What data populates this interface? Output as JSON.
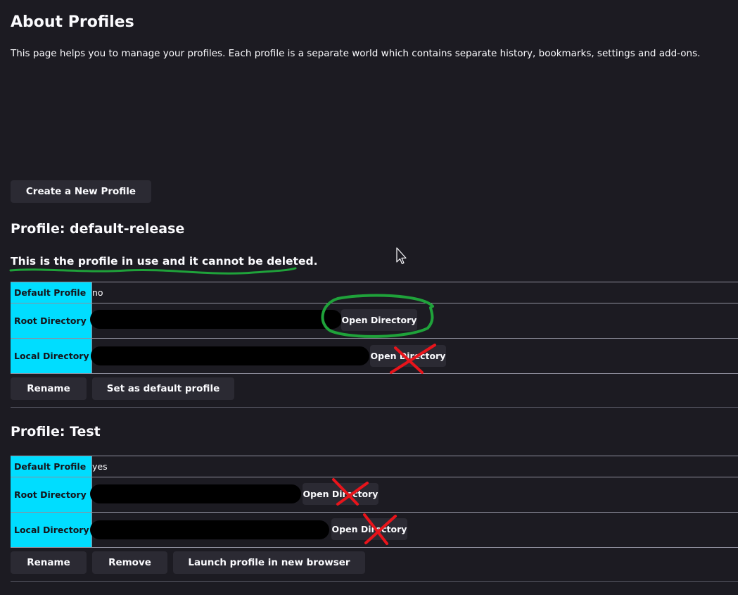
{
  "page": {
    "title": "About Profiles",
    "description": "This page helps you to manage your profiles. Each profile is a separate world which contains separate history, bookmarks, settings and add-ons.",
    "create_button": "Create a New Profile"
  },
  "labels": {
    "default_profile": "Default Profile",
    "root_directory": "Root Directory",
    "local_directory": "Local Directory",
    "open_directory": "Open Directory"
  },
  "profiles": [
    {
      "heading": "Profile: default-release",
      "in_use_note": "This is the profile in use and it cannot be deleted.",
      "default_value": "no",
      "buttons": {
        "rename": "Rename",
        "set_default": "Set as default profile"
      }
    },
    {
      "heading": "Profile: Test",
      "default_value": "yes",
      "buttons": {
        "rename": "Rename",
        "remove": "Remove",
        "launch": "Launch profile in new browser"
      }
    }
  ],
  "annotations": {
    "highlight_color": "#1fa23a",
    "reject_color": "#e8141b"
  }
}
